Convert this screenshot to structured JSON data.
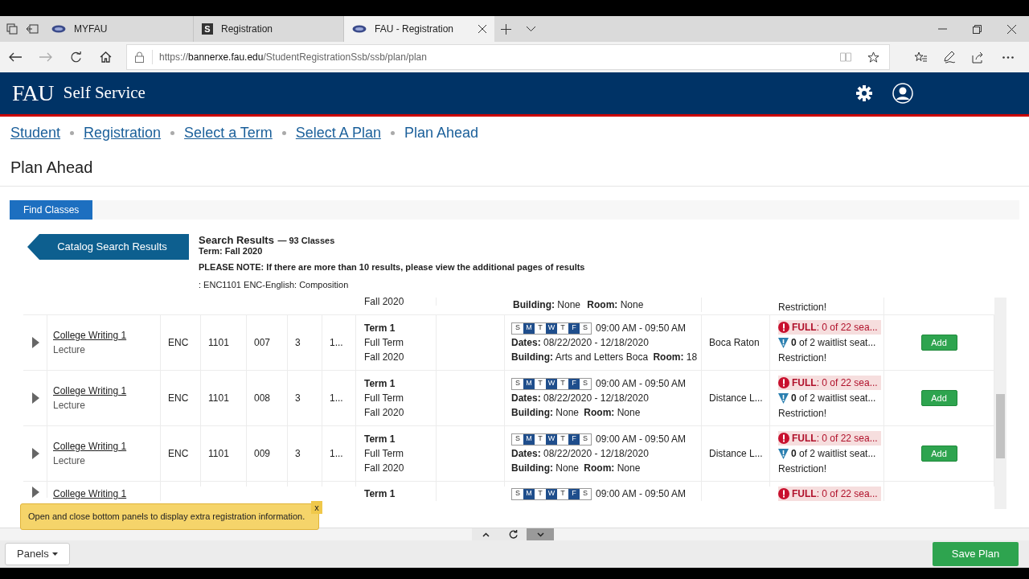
{
  "browser": {
    "tabs": [
      {
        "title": "MYFAU",
        "kind": "fau",
        "selected": false
      },
      {
        "title": "Registration",
        "kind": "letter",
        "letter": "S",
        "selected": false
      },
      {
        "title": "FAU - Registration",
        "kind": "fau",
        "selected": true
      }
    ],
    "url_prefix": "https://",
    "url_host": "bannerxe.fau.edu",
    "url_path": "/StudentRegistrationSsb/ssb/plan/plan"
  },
  "header": {
    "logo": "FAU",
    "title": "Self Service"
  },
  "breadcrumbs": [
    {
      "label": "Student",
      "current": false
    },
    {
      "label": "Registration",
      "current": false
    },
    {
      "label": "Select a Term",
      "current": false
    },
    {
      "label": "Select A Plan",
      "current": false
    },
    {
      "label": "Plan Ahead",
      "current": true
    }
  ],
  "page_title": "Plan Ahead",
  "find_classes": {
    "label": "Find Classes",
    "selected": true
  },
  "results": {
    "back_button": "Catalog Search Results",
    "title": "Search Results",
    "count": "— 93 Classes",
    "term": "Term: Fall 2020",
    "note": "PLEASE NOTE: If there are more than 10 results, please view the additional pages of results",
    "filter": ": ENC1101 ENC-English: Composition"
  },
  "table": {
    "rows": [
      {
        "kind": "tail",
        "term_line": "Fall 2020",
        "building_label": "Building:",
        "building": "None",
        "room_label": "Room:",
        "room": "None",
        "restriction": "Restriction!"
      },
      {
        "kind": "full",
        "title": "College Writing 1",
        "schedule_type": "Lecture",
        "subject": "ENC",
        "course": "1101",
        "section": "007",
        "hours": "3",
        "crn": "1...",
        "term": [
          "Term 1",
          "Full Term",
          "Fall 2020"
        ],
        "days": [
          {
            "letter": "S",
            "on": false
          },
          {
            "letter": "M",
            "on": true
          },
          {
            "letter": "T",
            "on": false
          },
          {
            "letter": "W",
            "on": true
          },
          {
            "letter": "T",
            "on": false
          },
          {
            "letter": "F",
            "on": true
          },
          {
            "letter": "S",
            "on": false
          }
        ],
        "time": "09:00 AM - 09:50 AM",
        "dates_label": "Dates:",
        "dates": "08/22/2020 - 12/18/2020",
        "building_label": "Building:",
        "building": "Arts and Letters Boca",
        "room_label": "Room:",
        "room": "18",
        "campus": "Boca Raton",
        "status": "FULL",
        "status_text": ": 0 of 22 sea...",
        "waitlist": "0",
        "waitlist_text": " of 2 waitlist seat...",
        "restriction": "Restriction!",
        "add": "Add"
      },
      {
        "kind": "full",
        "title": "College Writing 1",
        "schedule_type": "Lecture",
        "subject": "ENC",
        "course": "1101",
        "section": "008",
        "hours": "3",
        "crn": "1...",
        "term": [
          "Term 1",
          "Full Term",
          "Fall 2020"
        ],
        "days": [
          {
            "letter": "S",
            "on": false
          },
          {
            "letter": "M",
            "on": true
          },
          {
            "letter": "T",
            "on": false
          },
          {
            "letter": "W",
            "on": true
          },
          {
            "letter": "T",
            "on": false
          },
          {
            "letter": "F",
            "on": true
          },
          {
            "letter": "S",
            "on": false
          }
        ],
        "time": "09:00 AM - 09:50 AM",
        "dates_label": "Dates:",
        "dates": "08/22/2020 - 12/18/2020",
        "building_label": "Building:",
        "building": "None",
        "room_label": "Room:",
        "room": "None",
        "campus": "Distance L...",
        "status": "FULL",
        "status_text": ": 0 of 22 sea...",
        "waitlist": "0",
        "waitlist_text": " of 2 waitlist seat...",
        "restriction": "Restriction!",
        "add": "Add"
      },
      {
        "kind": "full",
        "title": "College Writing 1",
        "schedule_type": "Lecture",
        "subject": "ENC",
        "course": "1101",
        "section": "009",
        "hours": "3",
        "crn": "1...",
        "term": [
          "Term 1",
          "Full Term",
          "Fall 2020"
        ],
        "days": [
          {
            "letter": "S",
            "on": false
          },
          {
            "letter": "M",
            "on": true
          },
          {
            "letter": "T",
            "on": false
          },
          {
            "letter": "W",
            "on": true
          },
          {
            "letter": "T",
            "on": false
          },
          {
            "letter": "F",
            "on": true
          },
          {
            "letter": "S",
            "on": false
          }
        ],
        "time": "09:00 AM - 09:50 AM",
        "dates_label": "Dates:",
        "dates": "08/22/2020 - 12/18/2020",
        "building_label": "Building:",
        "building": "None",
        "room_label": "Room:",
        "room": "None",
        "campus": "Distance L...",
        "status": "FULL",
        "status_text": ": 0 of 22 sea...",
        "waitlist": "0",
        "waitlist_text": " of 2 waitlist seat...",
        "restriction": "Restriction!",
        "add": "Add"
      },
      {
        "kind": "head",
        "title": "College Writing 1",
        "term": [
          "Term 1"
        ],
        "days": [
          {
            "letter": "S",
            "on": false
          },
          {
            "letter": "M",
            "on": true
          },
          {
            "letter": "T",
            "on": false
          },
          {
            "letter": "W",
            "on": true
          },
          {
            "letter": "T",
            "on": false
          },
          {
            "letter": "F",
            "on": true
          },
          {
            "letter": "S",
            "on": false
          }
        ],
        "time": "09:00 AM - 09:50 AM",
        "status": "FULL",
        "status_text": ": 0 of 22 sea..."
      }
    ]
  },
  "tooltip": {
    "text": "Open and close bottom panels to display extra registration information.",
    "close": "x"
  },
  "footer": {
    "panels": "Panels",
    "save": "Save Plan"
  }
}
